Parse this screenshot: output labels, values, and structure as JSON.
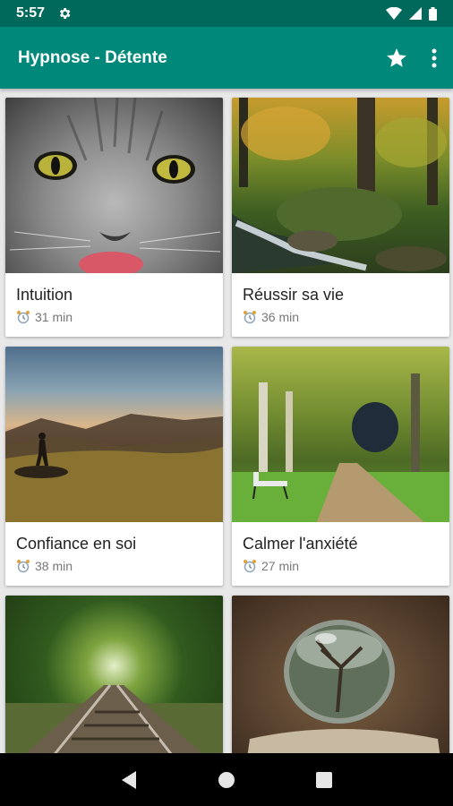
{
  "status": {
    "time": "5:57"
  },
  "app_bar": {
    "title": "Hypnose - Détente"
  },
  "cards": [
    {
      "title": "Intuition",
      "duration": "31 min"
    },
    {
      "title": "Réussir sa vie",
      "duration": "36 min"
    },
    {
      "title": "Confiance en soi",
      "duration": "38 min"
    },
    {
      "title": "Calmer l'anxiété",
      "duration": "27 min"
    },
    {
      "title": "",
      "duration": ""
    },
    {
      "title": "",
      "duration": ""
    }
  ],
  "images": [
    "cat-face-photo",
    "forest-stream-photo",
    "hiker-hill-sunset-photo",
    "park-path-bench-photo",
    "railway-forest-photo",
    "glass-sphere-photo"
  ],
  "colors": {
    "status_bar": "#00695c",
    "app_bar": "#00897b",
    "nav_bar": "#000000"
  }
}
